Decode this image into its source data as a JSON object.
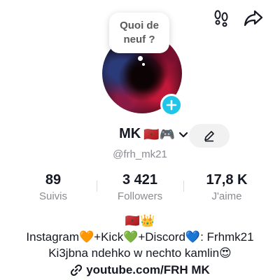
{
  "bubble": {
    "line1": "Quoi de",
    "line2": "neuf ?"
  },
  "profile": {
    "name": "MK",
    "name_emojis": "🇲🇦🎮",
    "handle": "@frh_mk21"
  },
  "stats": [
    {
      "value": "89",
      "label": "Suivis"
    },
    {
      "value": "3 421",
      "label": "Followers"
    },
    {
      "value": "17,8 K",
      "label": "J'aime"
    }
  ],
  "bio": {
    "line1": "🇲🇦👑",
    "line2": "Instagram🧡+Kick💚+Discord💙: Frhmk21",
    "line3": "Ki3jbna ndehko w nechto kamlin😍"
  },
  "link": {
    "text": "youtube.com/FRH MK"
  },
  "icons": {
    "footprints": "footprints-icon",
    "share": "share-arrow-icon",
    "add": "plus-icon",
    "chevron": "chevron-down-icon",
    "edit": "pencil-icon",
    "link": "link-icon"
  },
  "colors": {
    "accent": "#20c5e8",
    "text": "#161823",
    "muted": "#8a8b91",
    "button_bg": "#f1f1f2"
  }
}
